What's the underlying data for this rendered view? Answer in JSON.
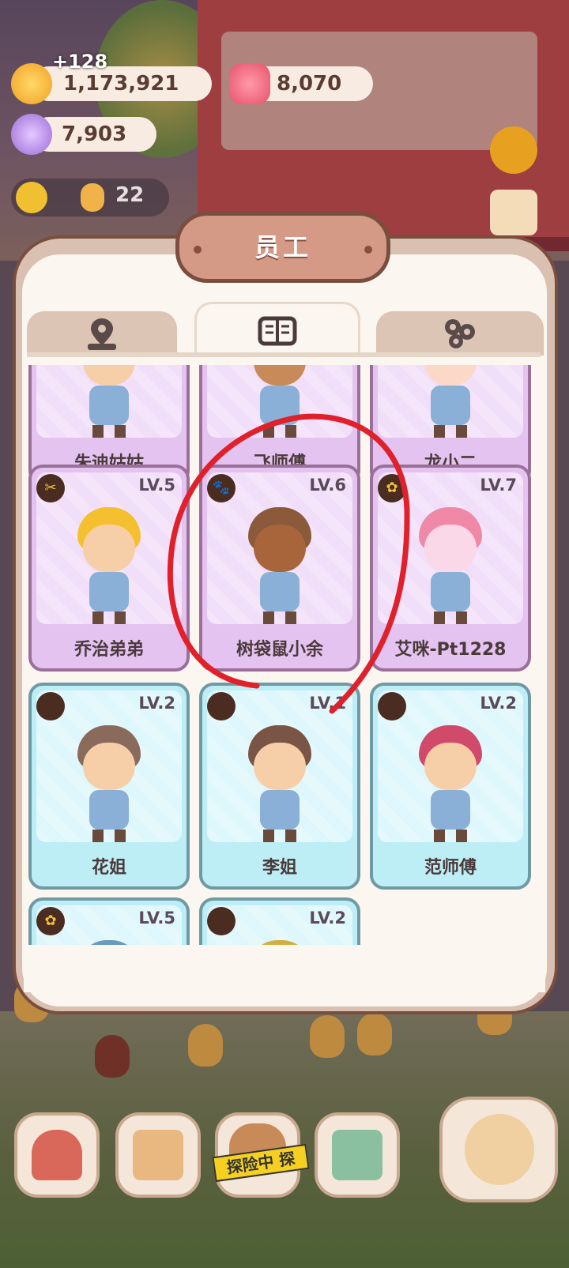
{
  "resources": {
    "gold": "1,173,921",
    "gold_gain": "+128",
    "candy": "8,070",
    "gem": "7,903",
    "workers": "22"
  },
  "popup": {
    "title": "员工",
    "tabs": [
      {
        "name": "location",
        "icon": "map-pin-icon",
        "active": false
      },
      {
        "name": "staff",
        "icon": "book-icon",
        "active": true
      },
      {
        "name": "other",
        "icon": "gear-cluster-icon",
        "active": false
      }
    ]
  },
  "staff_cards": [
    {
      "name": "朱迪姑姑",
      "level": "",
      "color": "purple",
      "badge": ""
    },
    {
      "name": "飞师傅",
      "level": "",
      "color": "purple",
      "badge": ""
    },
    {
      "name": "龙小二",
      "level": "",
      "color": "purple",
      "badge": ""
    },
    {
      "name": "乔治弟弟",
      "level": "LV.5",
      "color": "purple",
      "badge": "scissors-icon"
    },
    {
      "name": "树袋鼠小余",
      "level": "LV.6",
      "color": "purple",
      "badge": "paw-icon"
    },
    {
      "name": "艾咪-Pt1228",
      "level": "LV.7",
      "color": "purple",
      "badge": "flower-icon"
    },
    {
      "name": "花姐",
      "level": "LV.2",
      "color": "blue",
      "badge": "empty"
    },
    {
      "name": "李姐",
      "level": "LV.1",
      "color": "blue",
      "badge": "empty"
    },
    {
      "name": "范师傅",
      "level": "LV.2",
      "color": "blue",
      "badge": "empty"
    },
    {
      "name": "",
      "level": "LV.5",
      "color": "blue",
      "badge": "flower-icon"
    },
    {
      "name": "",
      "level": "LV.2",
      "color": "blue",
      "badge": "empty"
    }
  ],
  "bottom_bar": {
    "exploring_label": "探险中 探",
    "buttons": [
      "mushroom-house-icon",
      "calendar-icon",
      "explore-icon",
      "shop-icon",
      "fish-character-icon"
    ]
  },
  "colors": {
    "purple_card": "#e4c3f1",
    "blue_card": "#bdeef6",
    "annotation_red": "#e0202a"
  }
}
